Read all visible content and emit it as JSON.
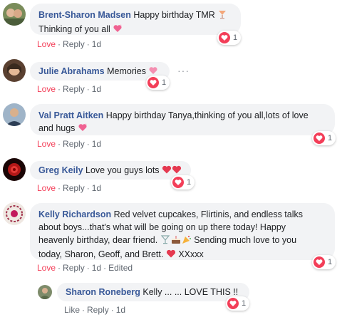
{
  "comments": [
    {
      "author": "Brent-Sharon Madsen",
      "text_line1": "Happy birthday TMR",
      "text_line2": "Thinking of you all",
      "reaction": "Love",
      "reply": "Reply",
      "time": "1d",
      "reaction_count": "1"
    },
    {
      "author": "Julie Abrahams",
      "text": "Memories",
      "reaction": "Love",
      "reply": "Reply",
      "time": "1d",
      "reaction_count": "1"
    },
    {
      "author": "Val Pratt Aitken",
      "text_line1": "Happy birthday Tanya,thinking of you all,lots of love",
      "text_line2": "and hugs",
      "reaction": "Love",
      "reply": "Reply",
      "time": "1d",
      "reaction_count": "1"
    },
    {
      "author": "Greg Keily",
      "text": "Love you guys lots",
      "reaction": "Love",
      "reply": "Reply",
      "time": "1d",
      "reaction_count": "1"
    },
    {
      "author": "Kelly Richardson",
      "text_line1": "Red velvet cupcakes, Flirtinis, and endless talks",
      "text_line2": "about boys...that's what will be going on up there today! Happy",
      "text_line3a": "heavenly birthday, dear friend.",
      "text_line3b": "Sending much love to you",
      "text_line4a": "today, Sharon, Geoff, and Brett.",
      "text_line4b": "XXxxx",
      "reaction": "Love",
      "reply": "Reply",
      "time": "1d",
      "edited": "Edited",
      "reaction_count": "1"
    }
  ],
  "reply": {
    "author": "Sharon Roneberg",
    "text": "Kelly ... ... LOVE THIS !!",
    "like": "Like",
    "reply": "Reply",
    "time": "1d",
    "reaction_count": "1"
  },
  "more_options": "···",
  "dot": "·",
  "colors": {
    "author": "#385898",
    "love": "#f33e58",
    "bubble": "#f2f3f5",
    "meta": "#606770"
  }
}
